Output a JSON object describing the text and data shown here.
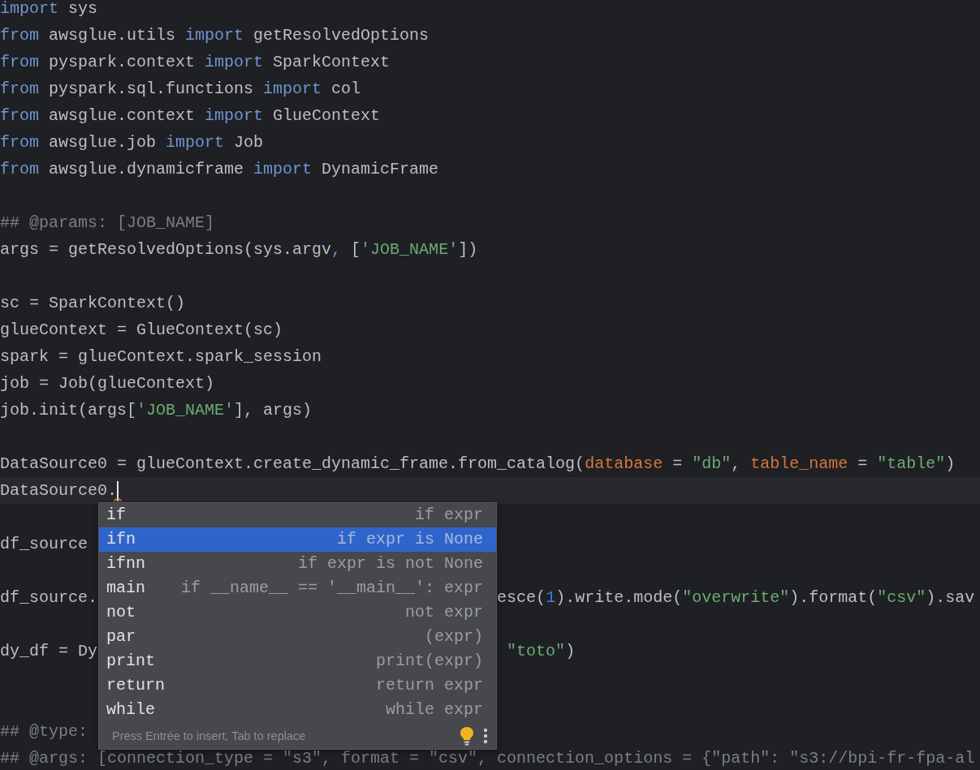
{
  "editor": {
    "lines": [
      {
        "kind": "code",
        "current": false,
        "tokens": [
          {
            "kind": "kw",
            "text": "import"
          },
          {
            "kind": "plain",
            "text": " sys"
          }
        ]
      },
      {
        "kind": "code",
        "current": false,
        "tokens": [
          {
            "kind": "kw",
            "text": "from"
          },
          {
            "kind": "plain",
            "text": " awsglue.utils "
          },
          {
            "kind": "kw",
            "text": "import"
          },
          {
            "kind": "plain",
            "text": " getResolvedOptions"
          }
        ]
      },
      {
        "kind": "code",
        "current": false,
        "tokens": [
          {
            "kind": "kw",
            "text": "from"
          },
          {
            "kind": "plain",
            "text": " pyspark.context "
          },
          {
            "kind": "kw",
            "text": "import"
          },
          {
            "kind": "plain",
            "text": " SparkContext"
          }
        ]
      },
      {
        "kind": "code",
        "current": false,
        "tokens": [
          {
            "kind": "kw",
            "text": "from"
          },
          {
            "kind": "plain",
            "text": " pyspark.sql.functions "
          },
          {
            "kind": "kw",
            "text": "import"
          },
          {
            "kind": "plain",
            "text": " col"
          }
        ]
      },
      {
        "kind": "code",
        "current": false,
        "tokens": [
          {
            "kind": "kw",
            "text": "from"
          },
          {
            "kind": "plain",
            "text": " awsglue.context "
          },
          {
            "kind": "kw",
            "text": "import"
          },
          {
            "kind": "plain",
            "text": " GlueContext"
          }
        ]
      },
      {
        "kind": "code",
        "current": false,
        "tokens": [
          {
            "kind": "kw",
            "text": "from"
          },
          {
            "kind": "plain",
            "text": " awsglue.job "
          },
          {
            "kind": "kw",
            "text": "import"
          },
          {
            "kind": "plain",
            "text": " Job"
          }
        ]
      },
      {
        "kind": "code",
        "current": false,
        "tokens": [
          {
            "kind": "kw",
            "text": "from"
          },
          {
            "kind": "plain",
            "text": " awsglue.dynamicframe "
          },
          {
            "kind": "kw",
            "text": "import"
          },
          {
            "kind": "plain",
            "text": " DynamicFrame"
          }
        ]
      },
      {
        "kind": "blank",
        "current": false
      },
      {
        "kind": "code",
        "current": false,
        "tokens": [
          {
            "kind": "comment",
            "text": "## @params: [JOB_NAME]"
          }
        ]
      },
      {
        "kind": "code",
        "current": false,
        "tokens": [
          {
            "kind": "plain",
            "text": "args = getResolvedOptions(sys.argv"
          },
          {
            "kind": "kw",
            "text": ","
          },
          {
            "kind": "plain",
            "text": " ["
          },
          {
            "kind": "string",
            "text": "'JOB_NAME'"
          },
          {
            "kind": "plain",
            "text": "])"
          }
        ]
      },
      {
        "kind": "blank",
        "current": false
      },
      {
        "kind": "code",
        "current": false,
        "tokens": [
          {
            "kind": "plain",
            "text": "sc = SparkContext()"
          }
        ]
      },
      {
        "kind": "code",
        "current": false,
        "tokens": [
          {
            "kind": "plain",
            "text": "glueContext = GlueContext(sc)"
          }
        ]
      },
      {
        "kind": "code",
        "current": false,
        "tokens": [
          {
            "kind": "plain",
            "text": "spark = glueContext.spark_session"
          }
        ]
      },
      {
        "kind": "code",
        "current": false,
        "tokens": [
          {
            "kind": "plain",
            "text": "job = Job(glueContext)"
          }
        ]
      },
      {
        "kind": "code",
        "current": false,
        "tokens": [
          {
            "kind": "plain",
            "text": "job.init(args["
          },
          {
            "kind": "string",
            "text": "'JOB_NAME'"
          },
          {
            "kind": "plain",
            "text": "], args)"
          }
        ]
      },
      {
        "kind": "blank",
        "current": false
      },
      {
        "kind": "code",
        "current": false,
        "tokens": [
          {
            "kind": "plain",
            "text": "DataSource0 = glueContext.create_dynamic_frame.from_catalog("
          },
          {
            "kind": "param",
            "text": "database"
          },
          {
            "kind": "plain",
            "text": " = "
          },
          {
            "kind": "string",
            "text": "\"db\""
          },
          {
            "kind": "plain",
            "text": ", "
          },
          {
            "kind": "param",
            "text": "table_name"
          },
          {
            "kind": "plain",
            "text": " = "
          },
          {
            "kind": "string",
            "text": "\"table\""
          },
          {
            "kind": "plain",
            "text": ")"
          }
        ]
      },
      {
        "kind": "code",
        "current": true,
        "tokens": [
          {
            "kind": "plain",
            "text": "DataSource0."
          }
        ]
      },
      {
        "kind": "blank",
        "current": false
      },
      {
        "kind": "code",
        "current": false,
        "tokens": [
          {
            "kind": "plain",
            "text": "df_source"
          }
        ]
      },
      {
        "kind": "blank",
        "current": false
      },
      {
        "kind": "code",
        "current": false,
        "tokens": [
          {
            "kind": "plain",
            "text": "df_source."
          }
        ],
        "after": [
          {
            "kind": "plain",
            "text": "esce("
          },
          {
            "kind": "number",
            "text": "1"
          },
          {
            "kind": "plain",
            "text": ").write.mode("
          },
          {
            "kind": "string",
            "text": "\"overwrite\""
          },
          {
            "kind": "plain",
            "text": ").format("
          },
          {
            "kind": "string",
            "text": "\"csv\""
          },
          {
            "kind": "plain",
            "text": ").sav"
          }
        ]
      },
      {
        "kind": "blank",
        "current": false
      },
      {
        "kind": "code",
        "current": false,
        "tokens": [
          {
            "kind": "plain",
            "text": "dy_df = Dy"
          }
        ],
        "after": [
          {
            "kind": "string",
            "text": "\"toto\""
          },
          {
            "kind": "plain",
            "text": ")"
          }
        ]
      },
      {
        "kind": "blank",
        "current": false
      },
      {
        "kind": "blank",
        "current": false
      },
      {
        "kind": "code",
        "current": false,
        "tokens": [
          {
            "kind": "comment",
            "text": "## @type:"
          }
        ]
      },
      {
        "kind": "code",
        "current": false,
        "tokens": [
          {
            "kind": "comment",
            "text": "## @args: [connection_type = \"s3\", format = \"csv\", connection_options = {\"path\": \"s3://bpi-fr-fpa-al"
          }
        ]
      }
    ]
  },
  "completion": {
    "items": [
      {
        "name": "if",
        "hint": "if expr",
        "selected": false
      },
      {
        "name": "ifn",
        "hint": "if expr is None",
        "selected": true
      },
      {
        "name": "ifnn",
        "hint": "if expr is not None",
        "selected": false
      },
      {
        "name": "main",
        "hint": "if __name__ == '__main__': expr",
        "selected": false
      },
      {
        "name": "not",
        "hint": "not expr",
        "selected": false
      },
      {
        "name": "par",
        "hint": "(expr)",
        "selected": false
      },
      {
        "name": "print",
        "hint": "print(expr)",
        "selected": false
      },
      {
        "name": "return",
        "hint": "return expr",
        "selected": false
      },
      {
        "name": "while",
        "hint": "while expr",
        "selected": false
      }
    ],
    "footer": "Press Entrée to insert, Tab to replace"
  }
}
